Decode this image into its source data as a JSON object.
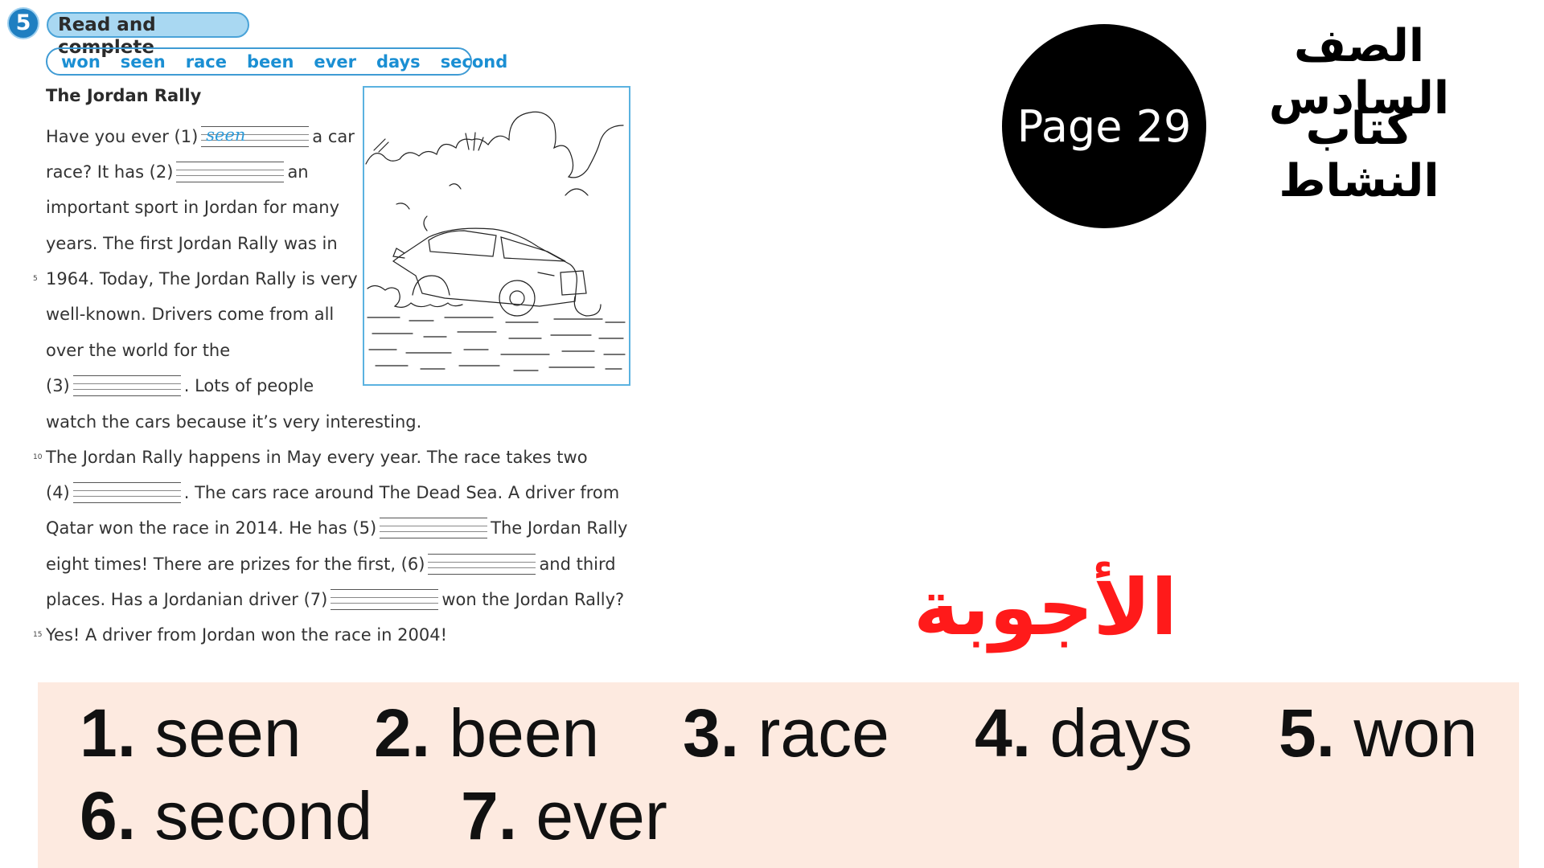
{
  "exercise": {
    "number": "5",
    "instruction": "Read and complete",
    "word_bank": [
      "won",
      "seen",
      "race",
      "been",
      "ever",
      "days",
      "second"
    ]
  },
  "passage": {
    "title": "The Jordan Rally",
    "lines": [
      {
        "num": "",
        "parts": [
          "Have you ever (1)",
          "a car"
        ],
        "blank_after": 0,
        "answer_filled": "seen"
      },
      {
        "num": "",
        "parts": [
          "race? It has (2)",
          "an"
        ]
      },
      {
        "num": "",
        "parts": [
          "important sport in Jordan for many"
        ]
      },
      {
        "num": "",
        "parts": [
          "years. The first Jordan Rally was in"
        ]
      },
      {
        "num": "5",
        "parts": [
          "1964. Today, The Jordan Rally is very"
        ]
      },
      {
        "num": "",
        "parts": [
          "well-known. Drivers come from all"
        ]
      },
      {
        "num": "",
        "parts": [
          "over the world for the"
        ]
      },
      {
        "num": "",
        "parts": [
          "(3)",
          ". Lots of people"
        ]
      },
      {
        "num": "",
        "parts": [
          "watch the cars because it’s very interesting."
        ]
      },
      {
        "num": "10",
        "parts": [
          "The Jordan Rally happens in May every year. The race takes two"
        ]
      },
      {
        "num": "",
        "parts": [
          "(4)",
          ". The cars race around The Dead Sea. A driver from"
        ]
      },
      {
        "num": "",
        "parts": [
          "Qatar won the race in 2014. He has (5)",
          "The Jordan Rally"
        ]
      },
      {
        "num": "",
        "parts": [
          "eight times! There are prizes for the first, (6)",
          "and third"
        ]
      },
      {
        "num": "",
        "parts": [
          "places. Has a Jordanian driver (7)",
          "won the Jordan Rally?"
        ]
      },
      {
        "num": "15",
        "parts": [
          "Yes! A driver from Jordan won the race in 2004!"
        ]
      }
    ]
  },
  "illustration": {
    "icon": "rally-car-illustration"
  },
  "header": {
    "page_label": "Page 29",
    "grade": "الصف السادس",
    "book": "كتاب النشاط"
  },
  "answers": {
    "title": "الأجوبة",
    "items": [
      {
        "n": "1.",
        "word": "seen"
      },
      {
        "n": "2.",
        "word": "been"
      },
      {
        "n": "3.",
        "word": "race"
      },
      {
        "n": "4.",
        "word": "days"
      },
      {
        "n": "5.",
        "word": "won"
      },
      {
        "n": "6.",
        "word": "second"
      },
      {
        "n": "7.",
        "word": "ever"
      }
    ]
  },
  "colors": {
    "accent_blue": "#1b8fd3",
    "answer_red": "#ff1a1a",
    "answers_bg": "#fdeae0"
  }
}
